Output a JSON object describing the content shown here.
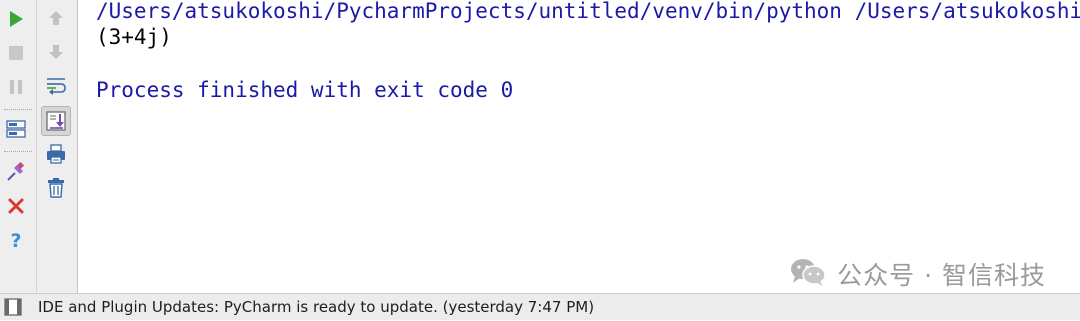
{
  "console": {
    "command_line": "/Users/atsukokoshi/PycharmProjects/untitled/venv/bin/python /Users/atsukokoshi/PycharmProjects/untitled/main.py",
    "output_line": "(3+4j)",
    "exit_line": "Process finished with exit code 0"
  },
  "watermark": {
    "text": "公众号 · 智信科技"
  },
  "status_bar": {
    "message": "IDE and Plugin Updates: PyCharm is ready to update. (yesterday 7:47 PM)"
  },
  "colors": {
    "console_system_text": "#1a1aa6",
    "console_output_text": "#000000",
    "run_green": "#3aa53a",
    "close_red": "#d93a2f",
    "help_blue": "#3a8fd8",
    "toolbar_bg": "#eeeeee",
    "statusbar_bg": "#ececec"
  },
  "icons": {
    "left_toolbar": [
      "run-icon",
      "stop-icon",
      "pause-icon",
      "restore-layout-icon",
      "pin-icon",
      "close-icon",
      "help-icon"
    ],
    "right_toolbar": [
      "up-arrow-icon",
      "down-arrow-icon",
      "soft-wrap-icon",
      "scroll-to-end-icon",
      "print-icon",
      "trash-icon"
    ],
    "status_bar": [
      "tool-window-toggle-icon"
    ],
    "watermark": [
      "wechat-icon"
    ]
  }
}
